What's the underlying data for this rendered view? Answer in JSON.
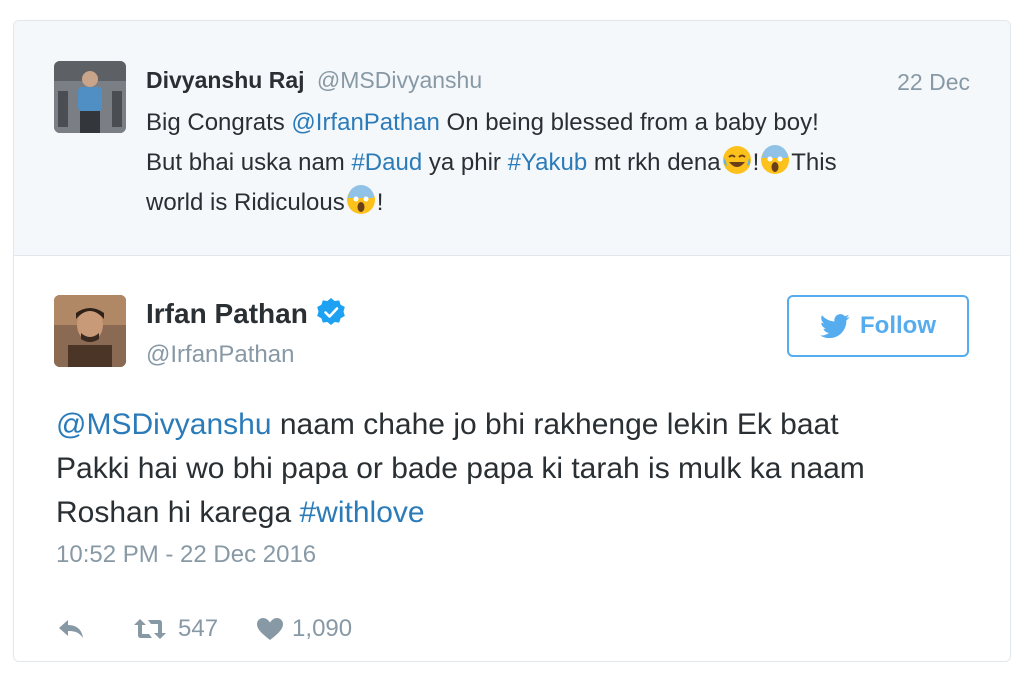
{
  "quoted": {
    "name": "Divyanshu Raj",
    "handle": "@MSDivyanshu",
    "date": "22 Dec",
    "text_parts": {
      "a": "Big Congrats ",
      "mention": "@IrfanPathan",
      "b": " On being blessed from a baby boy!",
      "c": "But bhai uska nam ",
      "tag1": "#Daud",
      "d": " ya phir ",
      "tag2": "#Yakub",
      "e": " mt rkh dena",
      "f": "!",
      "g": "This",
      "h": "world is Ridiculous",
      "i": "!"
    }
  },
  "tweet": {
    "name": "Irfan Pathan",
    "handle": "@IrfanPathan",
    "follow_label": "Follow",
    "text_parts": {
      "mention": "@MSDivyanshu",
      "a": " naam chahe jo bhi rakhenge lekin Ek baat",
      "b": "Pakki hai wo bhi papa or bade papa ki tarah is mulk ka naam",
      "c": "Roshan hi karega ",
      "tag": "#withlove"
    },
    "timestamp": "10:52 PM - 22 Dec 2016",
    "retweets": "547",
    "likes": "1,090"
  },
  "colors": {
    "link": "#2b7bb9",
    "accent": "#55acee",
    "muted": "#8899a6",
    "text": "#292f33"
  },
  "icons": [
    "reply-icon",
    "retweet-icon",
    "heart-icon",
    "twitter-bird-icon",
    "verified-badge-icon",
    "laughing-emoji",
    "screaming-emoji"
  ]
}
